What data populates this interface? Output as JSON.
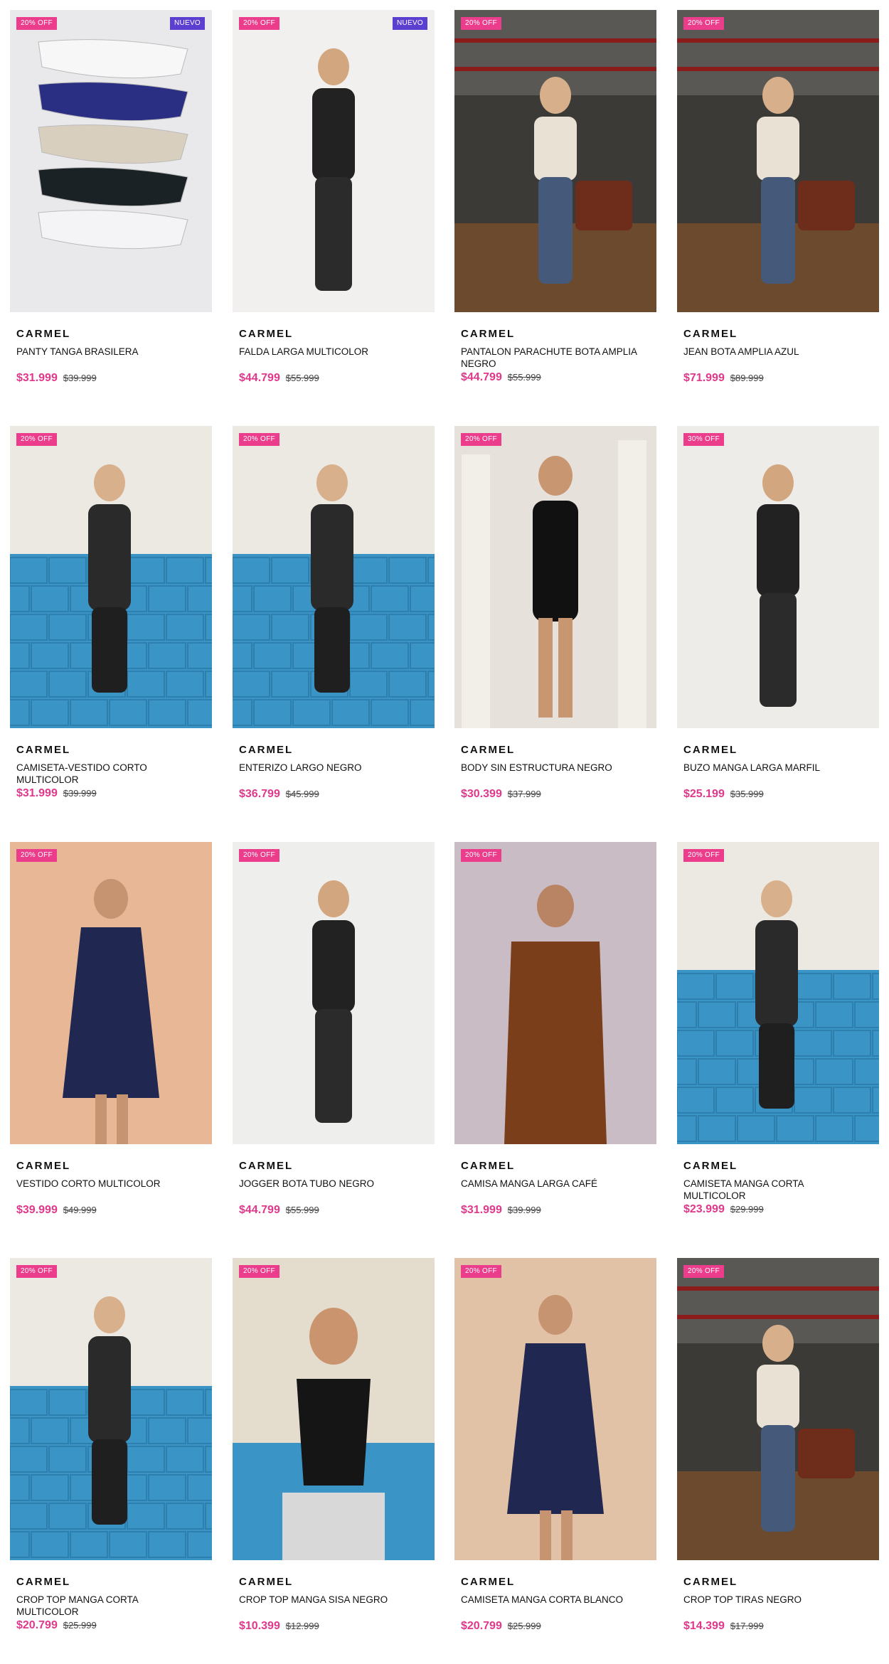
{
  "products": [
    {
      "brand": "CARMEL",
      "name": "PANTY TANGA BRASILERA",
      "price": "$31.999",
      "old_price": "$39.999",
      "discount": "20% OFF",
      "new_tag": "NUEVO",
      "scene": "panties",
      "bg": "#e9e9eb"
    },
    {
      "brand": "CARMEL",
      "name": "FALDA LARGA MULTICOLOR",
      "price": "$44.799",
      "old_price": "$55.999",
      "discount": "20% OFF",
      "new_tag": "NUEVO",
      "scene": "studio-white",
      "bg": "#f1f0ee"
    },
    {
      "brand": "CARMEL",
      "name": "PANTALON PARACHUTE BOTA AMPLIA NEGRO",
      "price": "$44.799",
      "old_price": "$55.999",
      "discount": "20% OFF",
      "new_tag": "",
      "scene": "garage",
      "bg": "#3c3a37"
    },
    {
      "brand": "CARMEL",
      "name": "JEAN BOTA AMPLIA AZUL",
      "price": "$71.999",
      "old_price": "$89.999",
      "discount": "20% OFF",
      "new_tag": "",
      "scene": "garage",
      "bg": "#3c3a37"
    },
    {
      "brand": "CARMEL",
      "name": "CAMISETA-VESTIDO CORTO MULTICOLOR",
      "price": "$31.999",
      "old_price": "$39.999",
      "discount": "20% OFF",
      "new_tag": "",
      "scene": "blue-tiles",
      "bg": "#ece8e2"
    },
    {
      "brand": "CARMEL",
      "name": "ENTERIZO LARGO NEGRO",
      "price": "$36.799",
      "old_price": "$45.999",
      "discount": "20% OFF",
      "new_tag": "",
      "scene": "blue-tiles",
      "bg": "#ece8e2"
    },
    {
      "brand": "CARMEL",
      "name": "BODY SIN ESTRUCTURA NEGRO",
      "price": "$30.399",
      "old_price": "$37.999",
      "discount": "20% OFF",
      "new_tag": "",
      "scene": "columns",
      "bg": "#e6e1da"
    },
    {
      "brand": "CARMEL",
      "name": "BUZO MANGA LARGA MARFIL",
      "price": "$25.199",
      "old_price": "$35.999",
      "discount": "30% OFF",
      "new_tag": "",
      "scene": "studio-white",
      "bg": "#eeece8"
    },
    {
      "brand": "CARMEL",
      "name": "VESTIDO CORTO MULTICOLOR",
      "price": "$39.999",
      "old_price": "$49.999",
      "discount": "20% OFF",
      "new_tag": "",
      "scene": "peach",
      "bg": "#e8b896"
    },
    {
      "brand": "CARMEL",
      "name": "JOGGER BOTA TUBO NEGRO",
      "price": "$44.799",
      "old_price": "$55.999",
      "discount": "20% OFF",
      "new_tag": "",
      "scene": "studio-white",
      "bg": "#eeeeec"
    },
    {
      "brand": "CARMEL",
      "name": "CAMISA MANGA LARGA CAFÉ",
      "price": "$31.999",
      "old_price": "$39.999",
      "discount": "20% OFF",
      "new_tag": "",
      "scene": "mauve",
      "bg": "#c9bcc4"
    },
    {
      "brand": "CARMEL",
      "name": "CAMISETA MANGA CORTA MULTICOLOR",
      "price": "$23.999",
      "old_price": "$29.999",
      "discount": "20% OFF",
      "new_tag": "",
      "scene": "blue-tiles",
      "bg": "#ece8e2"
    },
    {
      "brand": "CARMEL",
      "name": "CROP TOP MANGA CORTA MULTICOLOR",
      "price": "$20.799",
      "old_price": "$25.999",
      "discount": "20% OFF",
      "new_tag": "",
      "scene": "blue-tiles",
      "bg": "#ece8e2"
    },
    {
      "brand": "CARMEL",
      "name": "CROP TOP MANGA SISA NEGRO",
      "price": "$10.399",
      "old_price": "$12.999",
      "discount": "20% OFF",
      "new_tag": "",
      "scene": "beige-blue",
      "bg": "#e4dccd"
    },
    {
      "brand": "CARMEL",
      "name": "CAMISETA MANGA CORTA BLANCO",
      "price": "$20.799",
      "old_price": "$25.999",
      "discount": "20% OFF",
      "new_tag": "",
      "scene": "peach",
      "bg": "#e2c2a6"
    },
    {
      "brand": "CARMEL",
      "name": "CROP TOP TIRAS NEGRO",
      "price": "$14.399",
      "old_price": "$17.999",
      "discount": "20% OFF",
      "new_tag": "",
      "scene": "garage",
      "bg": "#3c3a37"
    }
  ]
}
